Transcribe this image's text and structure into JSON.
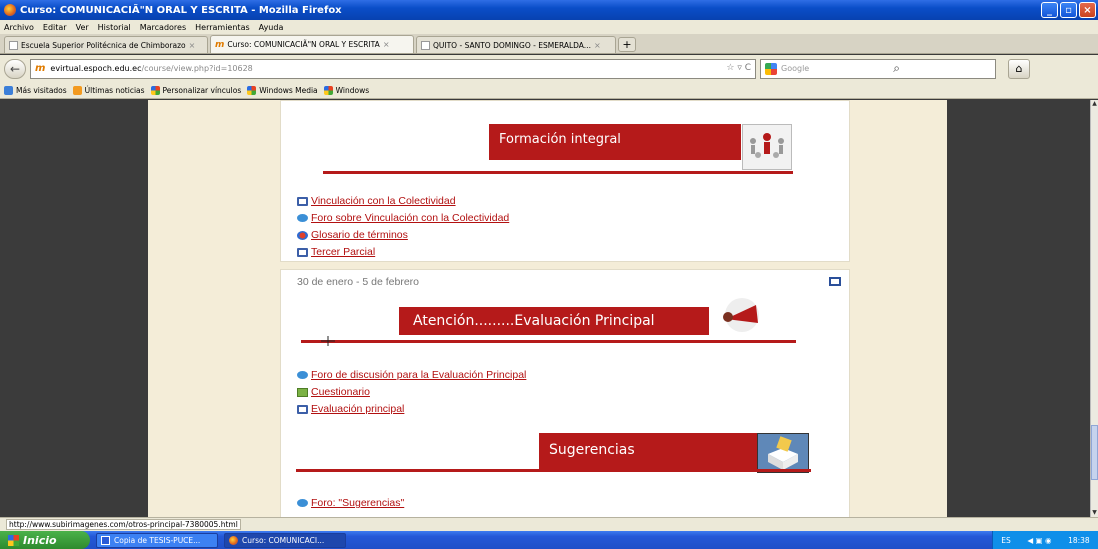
{
  "window": {
    "title": "Curso: COMUNICACIÃ\"N ORAL Y ESCRITA - Mozilla Firefox"
  },
  "menu": [
    "Archivo",
    "Editar",
    "Ver",
    "Historial",
    "Marcadores",
    "Herramientas",
    "Ayuda"
  ],
  "tabs": [
    {
      "label": "Escuela Superior Politécnica de Chimborazo"
    },
    {
      "label": "Curso: COMUNICACIÃ\"N ORAL Y ESCRITA"
    },
    {
      "label": "QUITO - SANTO DOMINGO - ESMERALDA..."
    }
  ],
  "nav": {
    "url_host": "evirtual.espoch.edu.ec",
    "url_path": "/course/view.php?id=10628",
    "search_placeholder": "Google"
  },
  "bookmarks": [
    "Más visitados",
    "Últimas noticias",
    "Personalizar vínculos",
    "Windows Media",
    "Windows"
  ],
  "section1": {
    "banner": "Formación integral",
    "links": [
      "Vinculación con la Colectividad",
      "Foro sobre Vinculación con la Colectividad",
      "Glosario de términos",
      "Tercer Parcial"
    ]
  },
  "section2": {
    "dates": "30 de enero - 5 de febrero",
    "banner1": "Atención.........Evaluación Principal",
    "links": [
      "Foro de discusión para la Evaluación Principal",
      "Cuestionario",
      "Evaluación principal"
    ],
    "banner2": "Sugerencias",
    "link2": "Foro: \"Sugerencias\""
  },
  "status": {
    "url": "http://www.subirimagenes.com/otros-principal-7380005.html"
  },
  "taskbar": {
    "start": "Inicio",
    "items": [
      "Copia de TESIS-PUCE...",
      "Curso: COMUNICACI..."
    ],
    "lang": "ES",
    "clock": "18:38"
  }
}
